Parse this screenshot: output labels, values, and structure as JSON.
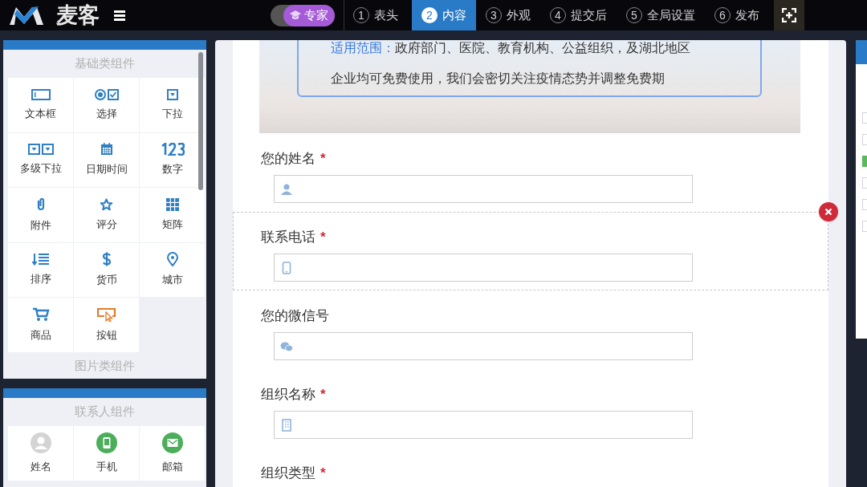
{
  "brand": {
    "name": "麦客"
  },
  "mode_toggle": {
    "label": "专家",
    "on": true
  },
  "steps": [
    {
      "number": "1",
      "label": "表头",
      "selected": false
    },
    {
      "number": "2",
      "label": "内容",
      "selected": true
    },
    {
      "number": "3",
      "label": "外观",
      "selected": false
    },
    {
      "number": "4",
      "label": "提交后",
      "selected": false
    },
    {
      "number": "5",
      "label": "全局设置",
      "selected": false
    },
    {
      "number": "6",
      "label": "发布",
      "selected": false
    }
  ],
  "panels": [
    {
      "sections": [
        {
          "title": "基础类组件",
          "items": [
            {
              "label": "文本框",
              "kind": "textbox"
            },
            {
              "label": "选择",
              "kind": "choice"
            },
            {
              "label": "下拉",
              "kind": "dropdown"
            },
            {
              "label": "多级下拉",
              "kind": "multidropdown"
            },
            {
              "label": "日期时间",
              "kind": "date"
            },
            {
              "label": "数字",
              "kind": "number"
            },
            {
              "label": "附件",
              "kind": "attachment"
            },
            {
              "label": "评分",
              "kind": "rating"
            },
            {
              "label": "矩阵",
              "kind": "matrix"
            },
            {
              "label": "排序",
              "kind": "sort"
            },
            {
              "label": "货币",
              "kind": "currency"
            },
            {
              "label": "城市",
              "kind": "city"
            },
            {
              "label": "商品",
              "kind": "product"
            },
            {
              "label": "按钮",
              "kind": "button"
            }
          ]
        },
        {
          "title": "图片类组件"
        }
      ]
    },
    {
      "sections": [
        {
          "title": "联系人组件",
          "items": [
            {
              "label": "姓名",
              "kind": "name"
            },
            {
              "label": "手机",
              "kind": "mobile"
            },
            {
              "label": "邮箱",
              "kind": "email"
            }
          ]
        }
      ]
    }
  ],
  "banner": {
    "lines": [
      {
        "label": "适用范围：",
        "text": "政府部门、医院、教育机构、公益组织，及湖北地区"
      },
      {
        "text": "企业均可免费使用，我们会密切关注疫情态势并调整免费期"
      }
    ]
  },
  "fields": [
    {
      "label": "您的姓名",
      "required_mark": "*",
      "selected": false,
      "kind": "person"
    },
    {
      "label": "联系电话",
      "required_mark": "*",
      "selected": true,
      "kind": "phone"
    },
    {
      "label": "您的微信号",
      "selected": false,
      "kind": "wechat"
    },
    {
      "label": "组织名称",
      "required_mark": "*",
      "selected": false,
      "kind": "building"
    },
    {
      "label": "组织类型",
      "required_mark": "*",
      "selected": false,
      "kind": "none"
    }
  ]
}
